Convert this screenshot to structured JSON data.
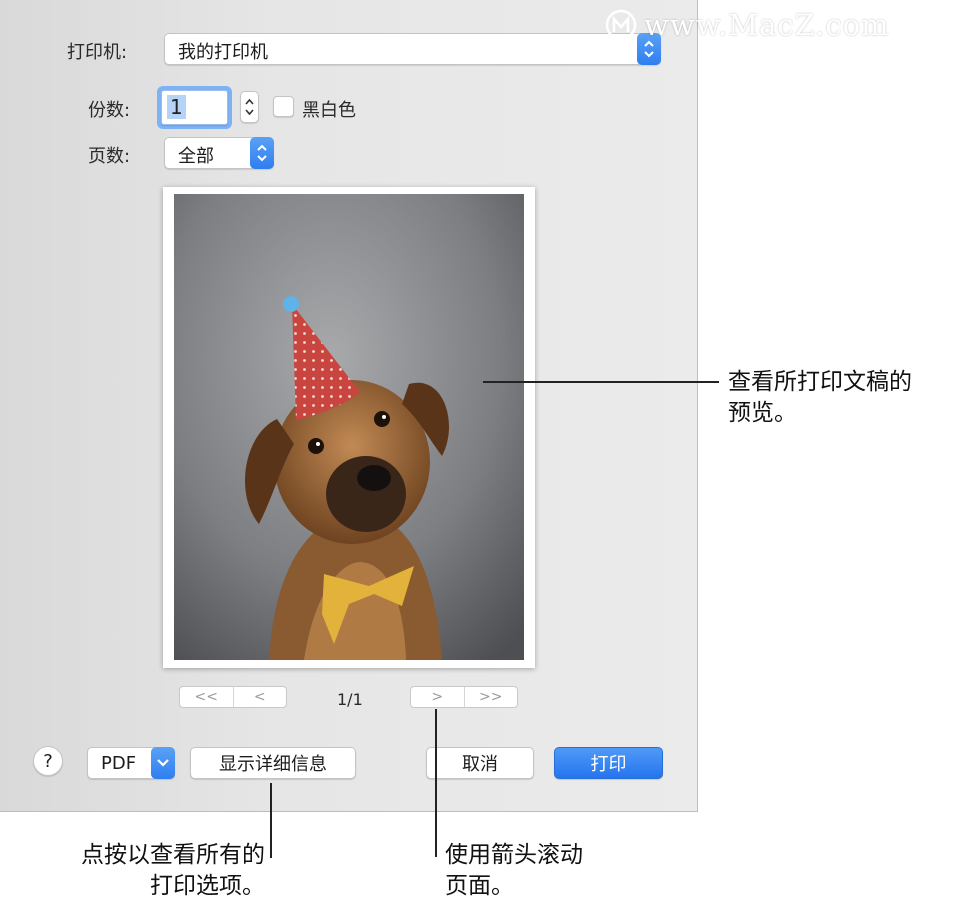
{
  "watermark": {
    "text": "www.MacZ.com"
  },
  "print_dialog": {
    "printer": {
      "label": "打印机:",
      "value": "我的打印机"
    },
    "copies": {
      "label": "份数:",
      "value": "1",
      "bw_label": "黑白色",
      "bw_checked": false
    },
    "pages": {
      "label": "页数:",
      "value": "全部"
    },
    "preview": {
      "image_subject": "dog-with-party-hat",
      "page_indicator": "1/1"
    },
    "nav": {
      "first": "<<",
      "prev": "<",
      "next": ">",
      "last": ">>"
    },
    "buttons": {
      "help": "?",
      "pdf": "PDF",
      "show_details": "显示详细信息",
      "cancel": "取消",
      "print": "打印"
    }
  },
  "callouts": {
    "preview": [
      "查看所打印文稿的",
      "预览。"
    ],
    "details": [
      "点按以查看所有的",
      "打印选项。"
    ],
    "arrows": [
      "使用箭头滚动",
      "页面。"
    ]
  },
  "colors": {
    "accent": "#2f7ef0",
    "dialog_bg": "#e6e6e6"
  }
}
